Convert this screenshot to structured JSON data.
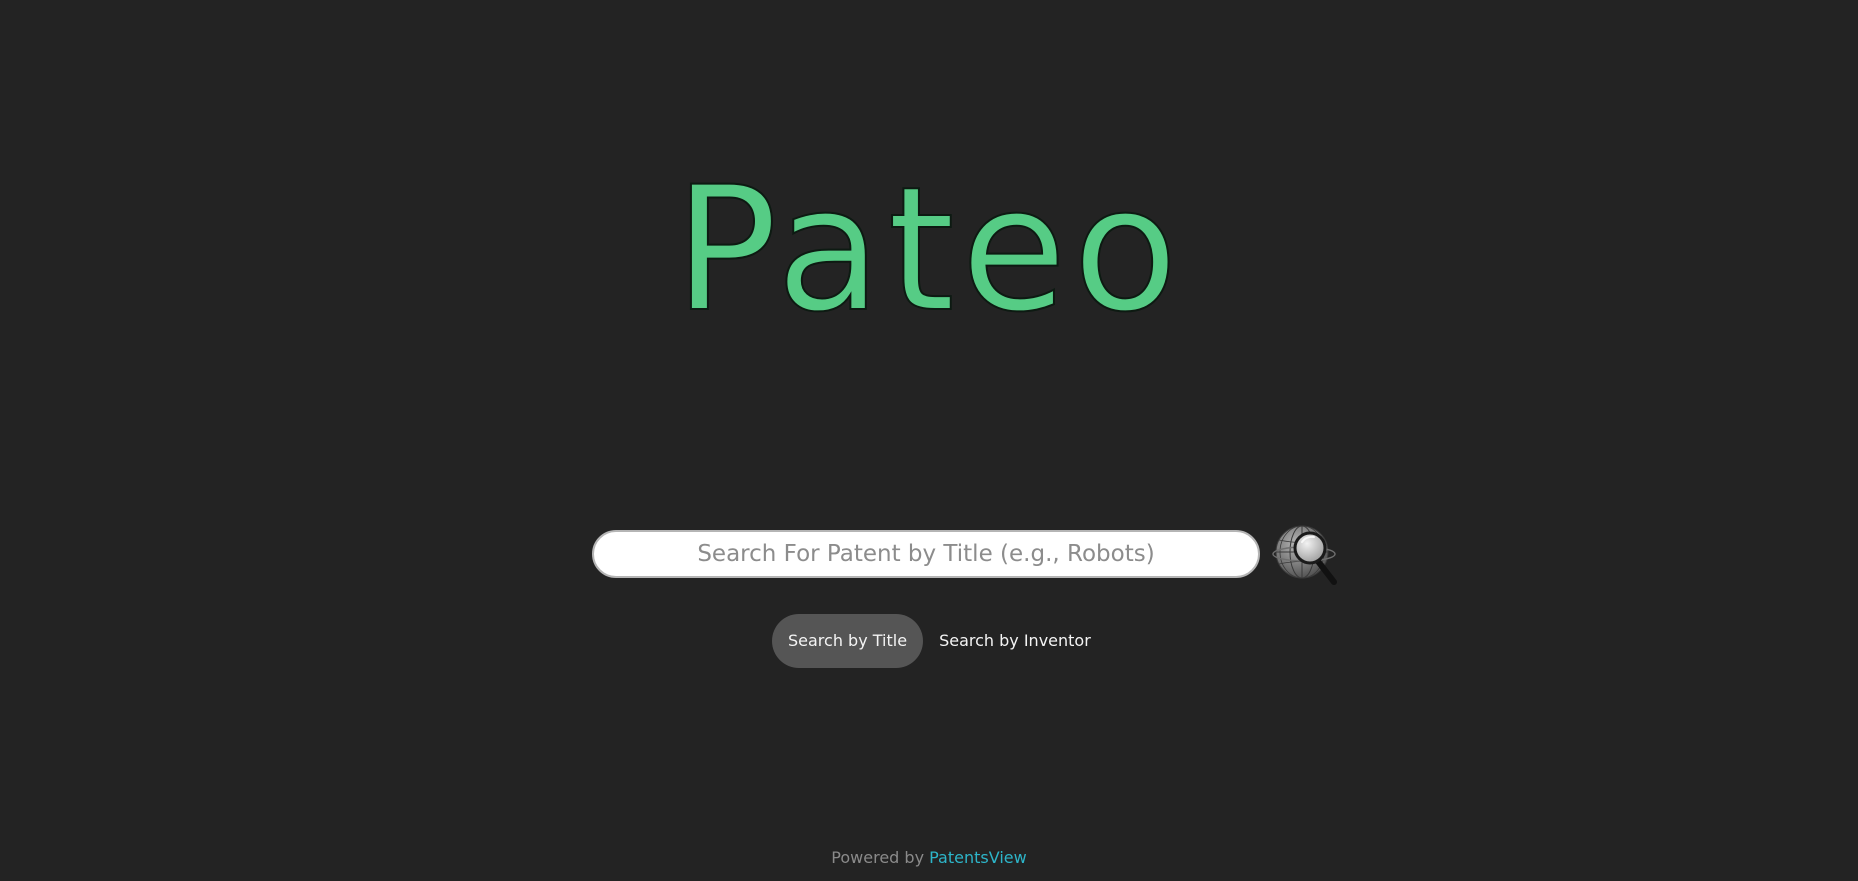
{
  "logo": {
    "text": "Pateo",
    "color": "#56cc85"
  },
  "search": {
    "placeholder": "Search For Patent by Title (e.g., Robots)",
    "value": "",
    "button_icon": "globe-magnifier-icon"
  },
  "modes": {
    "items": [
      {
        "label": "Search by Title",
        "active": true
      },
      {
        "label": "Search by Inventor",
        "active": false
      }
    ]
  },
  "footer": {
    "prefix": "Powered by ",
    "link_text": "PatentsView",
    "link_color": "#2db5c9"
  },
  "colors": {
    "background": "#232323",
    "active_tab": "#555555"
  }
}
